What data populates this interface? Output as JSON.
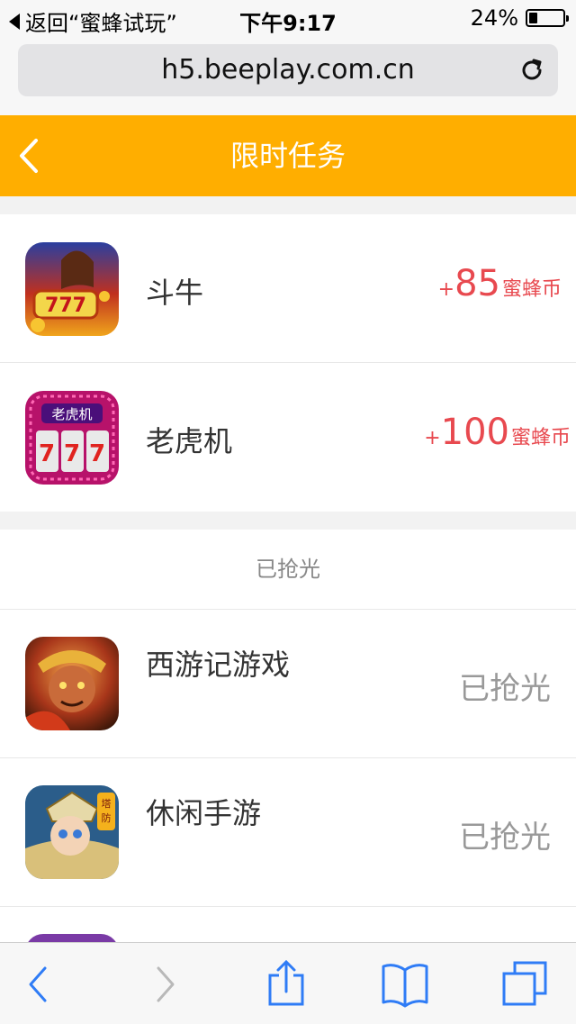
{
  "status_bar": {
    "back_app": "返回“蜜蜂试玩”",
    "time": "下午9:17",
    "battery_text": "24%",
    "battery_level": 0.24
  },
  "browser": {
    "url": "h5.beeplay.com.cn"
  },
  "header": {
    "title": "限时任务"
  },
  "tasks": [
    {
      "name": "斗牛",
      "plus": "+",
      "reward": "85",
      "unit": "蜜蜂币"
    },
    {
      "name": "老虎机",
      "plus": "+",
      "reward": "100",
      "unit": "蜜蜂币"
    }
  ],
  "soldout_section": {
    "title": "已抢光",
    "items": [
      {
        "name": "西游记游戏",
        "status": "已抢光"
      },
      {
        "name": "休闲手游",
        "status": "已抢光"
      }
    ]
  },
  "colors": {
    "header": "#ffae00",
    "reward": "#e8494f",
    "toolbar_tint": "#2f7cf6"
  }
}
